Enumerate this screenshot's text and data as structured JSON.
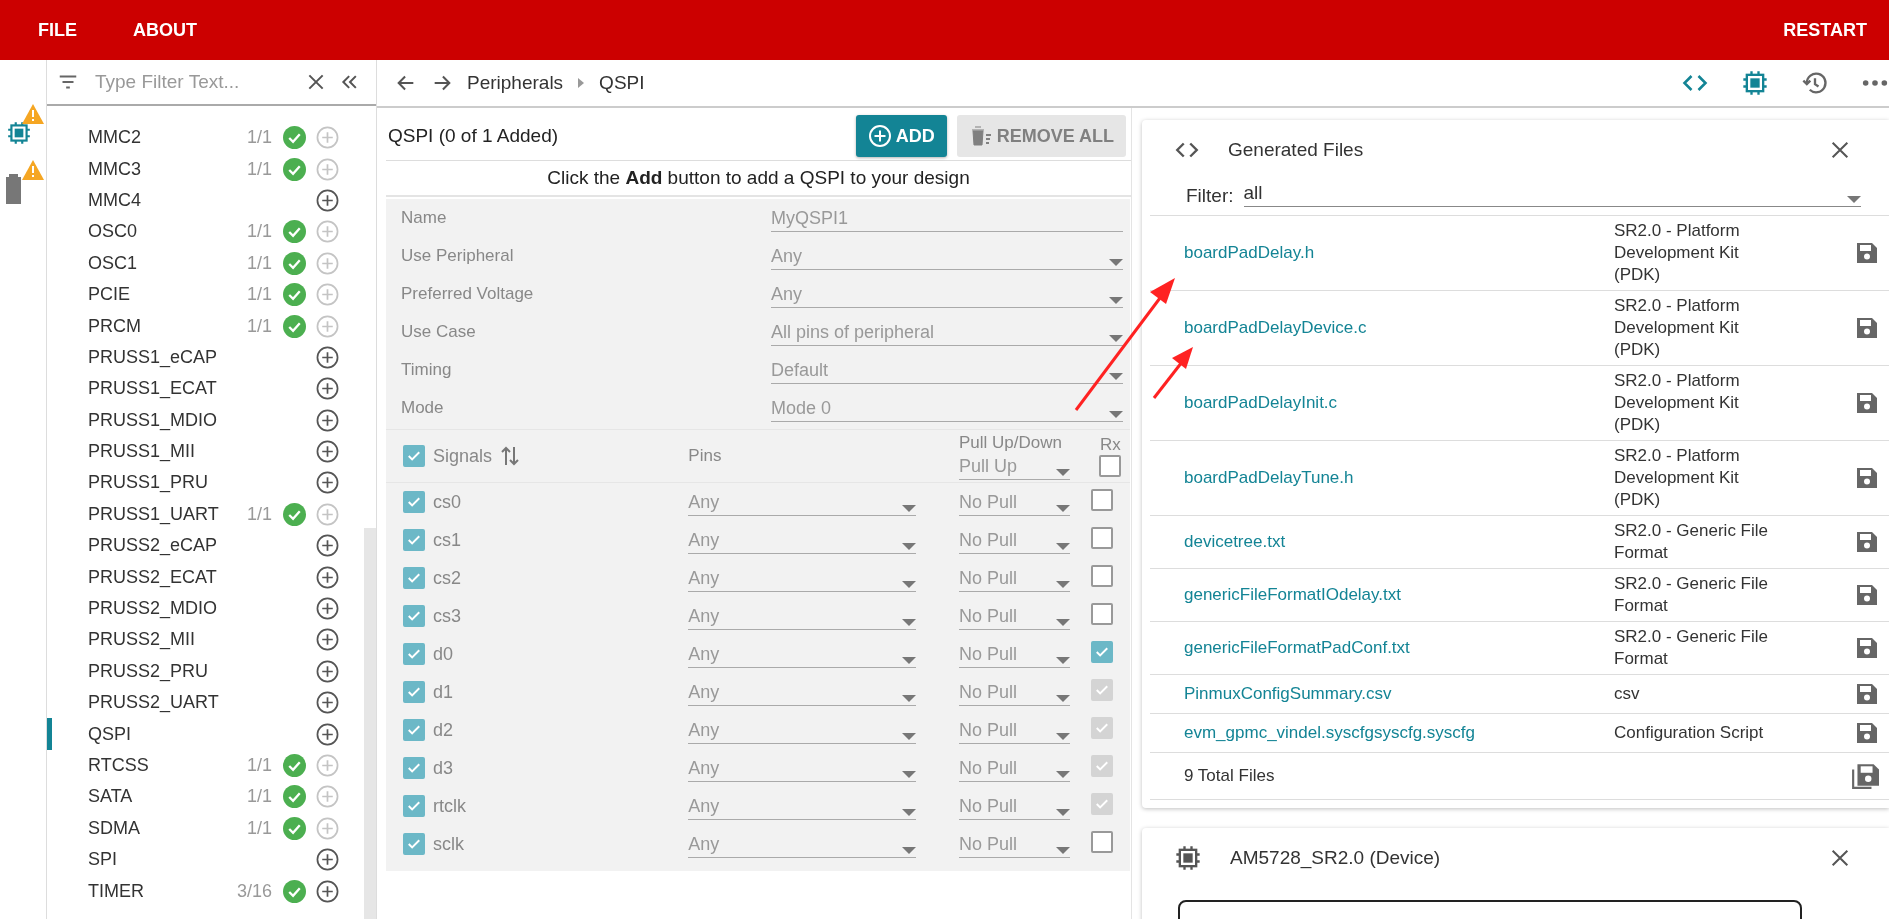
{
  "menu": [
    {
      "label": "FILE"
    },
    {
      "label": "ABOUT"
    }
  ],
  "restart": "RESTART",
  "rail": [
    {
      "kind": "chip",
      "warning": true
    },
    {
      "kind": "battery",
      "warning": true
    }
  ],
  "sidebar": {
    "filter_placeholder": "Type Filter Text...",
    "items": [
      {
        "name": "MMC2",
        "count": "1/1",
        "configured": true,
        "can_add": false,
        "selected": false
      },
      {
        "name": "MMC3",
        "count": "1/1",
        "configured": true,
        "can_add": false,
        "selected": false
      },
      {
        "name": "MMC4",
        "configured": false,
        "can_add": true,
        "selected": false
      },
      {
        "name": "OSC0",
        "count": "1/1",
        "configured": true,
        "can_add": false,
        "selected": false
      },
      {
        "name": "OSC1",
        "count": "1/1",
        "configured": true,
        "can_add": false,
        "selected": false
      },
      {
        "name": "PCIE",
        "count": "1/1",
        "configured": true,
        "can_add": false,
        "selected": false
      },
      {
        "name": "PRCM",
        "count": "1/1",
        "configured": true,
        "can_add": false,
        "selected": false
      },
      {
        "name": "PRUSS1_eCAP",
        "configured": false,
        "can_add": true,
        "selected": false
      },
      {
        "name": "PRUSS1_ECAT",
        "configured": false,
        "can_add": true,
        "selected": false
      },
      {
        "name": "PRUSS1_MDIO",
        "configured": false,
        "can_add": true,
        "selected": false
      },
      {
        "name": "PRUSS1_MII",
        "configured": false,
        "can_add": true,
        "selected": false
      },
      {
        "name": "PRUSS1_PRU",
        "configured": false,
        "can_add": true,
        "selected": false
      },
      {
        "name": "PRUSS1_UART",
        "count": "1/1",
        "configured": true,
        "can_add": false,
        "selected": false
      },
      {
        "name": "PRUSS2_eCAP",
        "configured": false,
        "can_add": true,
        "selected": false
      },
      {
        "name": "PRUSS2_ECAT",
        "configured": false,
        "can_add": true,
        "selected": false
      },
      {
        "name": "PRUSS2_MDIO",
        "configured": false,
        "can_add": true,
        "selected": false
      },
      {
        "name": "PRUSS2_MII",
        "configured": false,
        "can_add": true,
        "selected": false
      },
      {
        "name": "PRUSS2_PRU",
        "configured": false,
        "can_add": true,
        "selected": false
      },
      {
        "name": "PRUSS2_UART",
        "configured": false,
        "can_add": true,
        "selected": false
      },
      {
        "name": "QSPI",
        "configured": false,
        "can_add": true,
        "selected": true
      },
      {
        "name": "RTCSS",
        "count": "1/1",
        "configured": true,
        "can_add": false,
        "selected": false
      },
      {
        "name": "SATA",
        "count": "1/1",
        "configured": true,
        "can_add": false,
        "selected": false
      },
      {
        "name": "SDMA",
        "count": "1/1",
        "configured": true,
        "can_add": false,
        "selected": false
      },
      {
        "name": "SPI",
        "configured": false,
        "can_add": true,
        "selected": false
      },
      {
        "name": "TIMER",
        "count": "3/16",
        "configured": true,
        "can_add": true,
        "selected": false
      }
    ]
  },
  "breadcrumb": [
    "Peripherals",
    "QSPI"
  ],
  "toolbar": [
    {
      "kind": "code",
      "active": true
    },
    {
      "kind": "chip",
      "active": true
    },
    {
      "kind": "history",
      "active": false
    },
    {
      "kind": "more",
      "active": false
    }
  ],
  "module": {
    "title": "QSPI (0 of 1 Added)",
    "add_button": {
      "label": "ADD",
      "disabled": false
    },
    "remove_button": {
      "label": "REMOVE ALL",
      "disabled": true
    },
    "hint": "Click the **Add** button to add a QSPI to your design",
    "fields": [
      {
        "label": "Name",
        "value": "MyQSPI1",
        "kind": "text"
      },
      {
        "label": "Use Peripheral",
        "value": "Any",
        "kind": "select"
      },
      {
        "label": "Preferred Voltage",
        "value": "Any",
        "kind": "select"
      },
      {
        "label": "Use Case",
        "value": "All pins of peripheral",
        "kind": "select"
      },
      {
        "label": "Timing",
        "value": "Default",
        "kind": "select"
      },
      {
        "label": "Mode",
        "value": "Mode 0",
        "kind": "select"
      }
    ],
    "signals_header": {
      "label": "Signals",
      "checked": true,
      "pins": "Pins",
      "pull_label": "Pull Up/Down",
      "pull_value": "Pull Up",
      "rx_label": "Rx",
      "rx_checked": false
    },
    "signals": [
      {
        "name": "cs0",
        "checked": true,
        "pin": "Any",
        "pull": "No Pull",
        "rx": false,
        "rx_disabled": false
      },
      {
        "name": "cs1",
        "checked": true,
        "pin": "Any",
        "pull": "No Pull",
        "rx": false,
        "rx_disabled": false
      },
      {
        "name": "cs2",
        "checked": true,
        "pin": "Any",
        "pull": "No Pull",
        "rx": false,
        "rx_disabled": false
      },
      {
        "name": "cs3",
        "checked": true,
        "pin": "Any",
        "pull": "No Pull",
        "rx": false,
        "rx_disabled": false
      },
      {
        "name": "d0",
        "checked": true,
        "pin": "Any",
        "pull": "No Pull",
        "rx": true,
        "rx_disabled": false
      },
      {
        "name": "d1",
        "checked": true,
        "pin": "Any",
        "pull": "No Pull",
        "rx": true,
        "rx_disabled": true
      },
      {
        "name": "d2",
        "checked": true,
        "pin": "Any",
        "pull": "No Pull",
        "rx": true,
        "rx_disabled": true
      },
      {
        "name": "d3",
        "checked": true,
        "pin": "Any",
        "pull": "No Pull",
        "rx": true,
        "rx_disabled": true
      },
      {
        "name": "rtclk",
        "checked": true,
        "pin": "Any",
        "pull": "No Pull",
        "rx": true,
        "rx_disabled": true
      },
      {
        "name": "sclk",
        "checked": true,
        "pin": "Any",
        "pull": "No Pull",
        "rx": false,
        "rx_disabled": false
      }
    ]
  },
  "generated_files": {
    "title": "Generated Files",
    "filter_label": "Filter:",
    "filter_value": "all",
    "files": [
      {
        "name": "boardPadDelay.h",
        "type": "SR2.0 - Platform Development Kit (PDK)"
      },
      {
        "name": "boardPadDelayDevice.c",
        "type": "SR2.0 - Platform Development Kit (PDK)"
      },
      {
        "name": "boardPadDelayInit.c",
        "type": "SR2.0 - Platform Development Kit (PDK)"
      },
      {
        "name": "boardPadDelayTune.h",
        "type": "SR2.0 - Platform Development Kit (PDK)"
      },
      {
        "name": "devicetree.txt",
        "type": "SR2.0 - Generic File Format"
      },
      {
        "name": "genericFileFormatIOdelay.txt",
        "type": "SR2.0 - Generic File Format"
      },
      {
        "name": "genericFileFormatPadConf.txt",
        "type": "SR2.0 - Generic File Format"
      },
      {
        "name": "PinmuxConfigSummary.csv",
        "type": "csv"
      },
      {
        "name": "evm_gpmc_vindel.syscfgsyscfg.syscfg",
        "type": "Configuration Script"
      }
    ],
    "total": "9 Total Files"
  },
  "device": {
    "title": "AM5728_SR2.0 (Device)"
  }
}
